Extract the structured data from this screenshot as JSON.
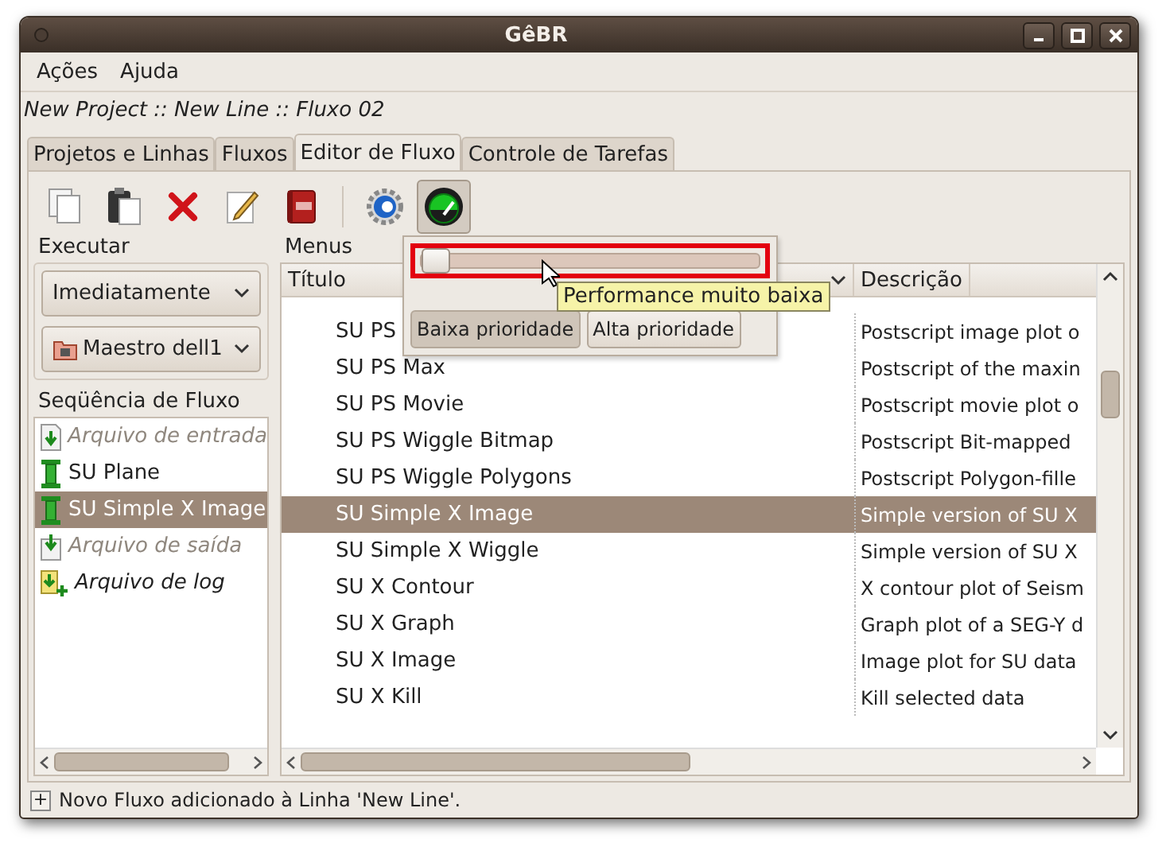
{
  "window": {
    "title": "GêBR"
  },
  "menu": [
    {
      "label": "Ações"
    },
    {
      "label": "Ajuda"
    }
  ],
  "breadcrumb": "New Project :: New Line :: Fluxo 02",
  "tabs": [
    {
      "label": "Projetos e Linhas",
      "selected": false
    },
    {
      "label": "Fluxos",
      "selected": false
    },
    {
      "label": "Editor de Fluxo",
      "selected": true
    },
    {
      "label": "Controle de Tarefas",
      "selected": false
    }
  ],
  "toolbar": [
    {
      "kind": "copy",
      "pressed": false
    },
    {
      "kind": "paste",
      "pressed": false
    },
    {
      "kind": "delete",
      "pressed": false
    },
    {
      "kind": "edit",
      "pressed": false
    },
    {
      "kind": "dictionary",
      "pressed": false
    },
    {
      "kind": "separator"
    },
    {
      "kind": "settings",
      "pressed": false
    },
    {
      "kind": "gauge",
      "pressed": true
    }
  ],
  "execute": {
    "label": "Executar",
    "mode": "Imediatamente",
    "server": "Maestro dell1"
  },
  "flow": {
    "label": "Seqüência de Fluxo",
    "items": [
      {
        "kind": "input",
        "label": "Arquivo de entrada",
        "enabled": false,
        "selected": false
      },
      {
        "kind": "program",
        "label": "SU Plane",
        "enabled": true,
        "selected": false
      },
      {
        "kind": "program",
        "label": "SU Simple X Image",
        "enabled": true,
        "selected": true
      },
      {
        "kind": "output",
        "label": "Arquivo de saída",
        "enabled": false,
        "selected": false
      },
      {
        "kind": "log",
        "label": "Arquivo de log",
        "enabled": true,
        "selected": false
      }
    ]
  },
  "menus": {
    "label": "Menus",
    "columns": [
      "Título",
      "Descrição"
    ],
    "rows": [
      {
        "title": "SU PS",
        "description": "Postscript image plot o",
        "selected": false
      },
      {
        "title": "SU PS Max",
        "description": "Postscript of the maxin",
        "selected": false
      },
      {
        "title": "SU PS Movie",
        "description": "Postscript movie plot o",
        "selected": false
      },
      {
        "title": "SU PS Wiggle Bitmap",
        "description": "Postscript Bit-mapped",
        "selected": false
      },
      {
        "title": "SU PS Wiggle Polygons",
        "description": "Postscript Polygon-fille",
        "selected": false
      },
      {
        "title": "SU Simple X Image",
        "description": "Simple version of SU X",
        "selected": true
      },
      {
        "title": "SU Simple X Wiggle",
        "description": "Simple version of SU X",
        "selected": false
      },
      {
        "title": "SU X Contour",
        "description": "X contour plot of Seism",
        "selected": false
      },
      {
        "title": "SU X Graph",
        "description": "Graph plot of a SEG-Y d",
        "selected": false
      },
      {
        "title": "SU X Image",
        "description": "Image plot for SU data",
        "selected": false
      },
      {
        "title": "SU X Kill",
        "description": "Kill selected data",
        "selected": false
      }
    ]
  },
  "priority_popup": {
    "level": 0,
    "tooltip": "Performance muito baixa",
    "buttons": [
      {
        "label": "Baixa prioridade",
        "pressed": true
      },
      {
        "label": "Alta prioridade",
        "pressed": false
      }
    ]
  },
  "status_bar": {
    "expander": "+",
    "message": "Novo Fluxo adicionado à Linha 'New Line'."
  }
}
